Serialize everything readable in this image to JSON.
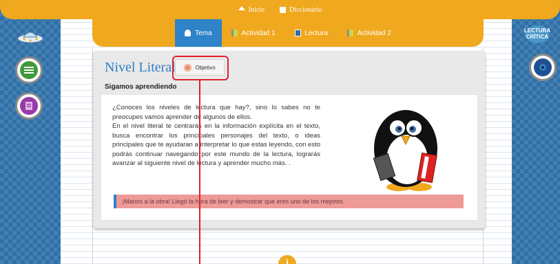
{
  "topnav": {
    "home_label": "Inicio",
    "dictionary_label": "Diccionario"
  },
  "tabs": [
    {
      "label": "Tema",
      "icon": "person-icon",
      "active": true
    },
    {
      "label": "Actividad 1",
      "icon": "activity-icon",
      "active": false
    },
    {
      "label": "Lectura",
      "icon": "book-icon",
      "active": false
    },
    {
      "label": "Actividad 2",
      "icon": "activity-icon",
      "active": false
    }
  ],
  "panel": {
    "title": "Nivel Literal",
    "objetivo_label": "Objetivo",
    "subheading": "Sigamos aprendiendo",
    "body_lines": [
      "¿Conoces los niveles de lectura que hay?, sino lo sabes no te preocupes vamos aprender de algunos de ellos.",
      "En el nivel literal te centrarás en la información explícita en el texto, busca encontrar los principales personajes del texto, o ideas principales que te ayudaran a interpretar lo que estas leyendo, con esto podrás continuar navegando por este mundo de la lectura, lograrás avanzar al siguiente nivel de lectura y aprender mucho más. ."
    ],
    "banner_text": "¡Manos a la obra! Llegó la hora de leer y demostrar que eres uno de los mejores."
  },
  "right_logo": {
    "line1": "LECTURA",
    "line2": "CRÍTICA"
  },
  "info_symbol": "i",
  "colors": {
    "orange": "#f0a81e",
    "blue": "#2f83c9",
    "side_blue": "#2f70a8",
    "annotation_red": "#e0202a",
    "banner_pink": "#ee9a97"
  }
}
